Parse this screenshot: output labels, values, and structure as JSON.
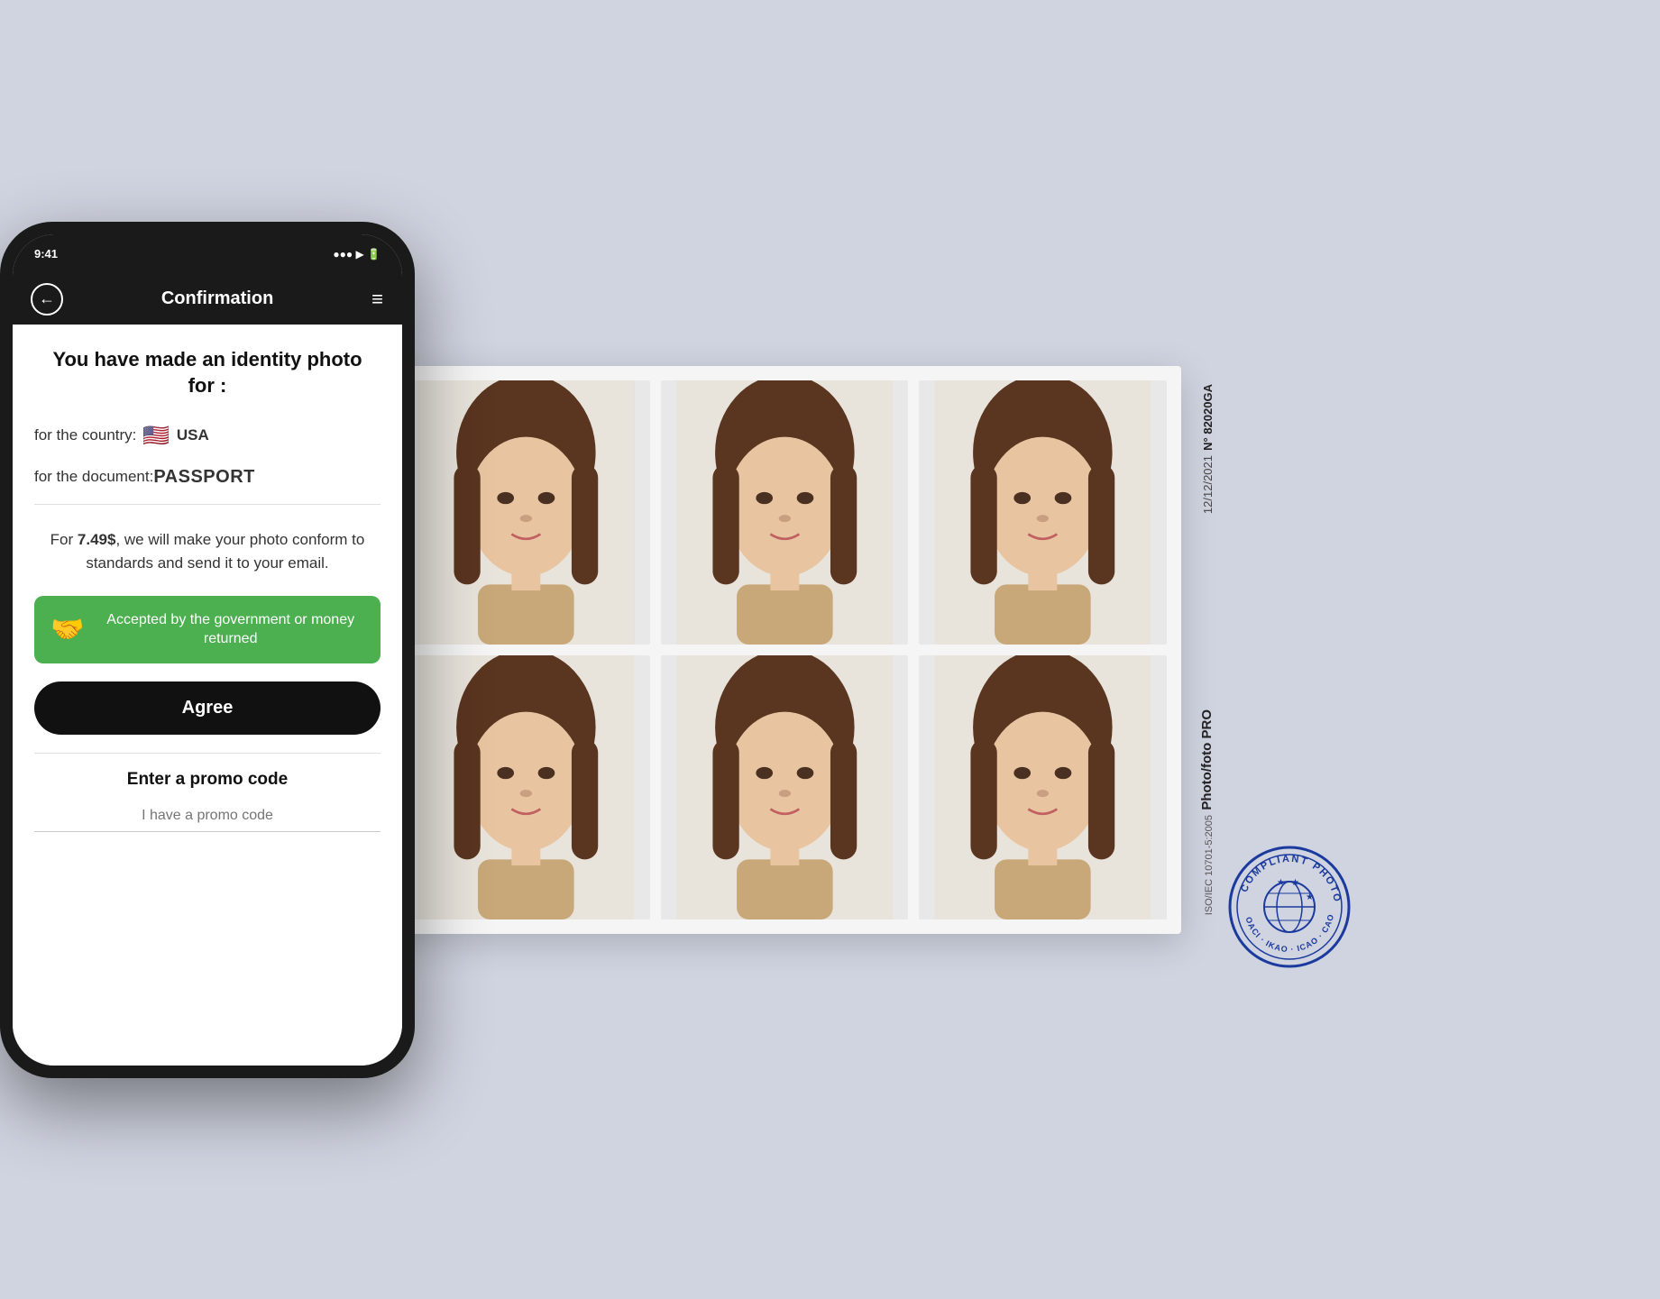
{
  "background_color": "#d0d4e0",
  "phone": {
    "nav": {
      "title": "Confirmation",
      "back_icon": "←",
      "menu_icon": "≡"
    },
    "screen": {
      "headline": "You have made an identity photo for :",
      "country_label": "for the country:",
      "country_value": "USA",
      "country_flag": "🇺🇸",
      "document_label": "for the document:",
      "document_value": "PASSPORT",
      "price_text_before": "For ",
      "price": "7.49$",
      "price_text_after": ", we will make your photo conform to standards and send it to your email.",
      "guarantee_text": "Accepted by the government or money returned",
      "agree_label": "Agree",
      "promo_label": "Enter a promo code",
      "promo_placeholder": "I have a promo code"
    }
  },
  "photo_sheet": {
    "sidebar_number": "N° 82020GA",
    "sidebar_date": "12/12/2021",
    "sidebar_brand": "Photo/foto PRO",
    "sidebar_iso": "ISO/IEC 10701-5:2005"
  },
  "stamp": {
    "text": "COMPLIANT PHOTOS",
    "subtext": "OACI · IKAO · ICAO"
  }
}
